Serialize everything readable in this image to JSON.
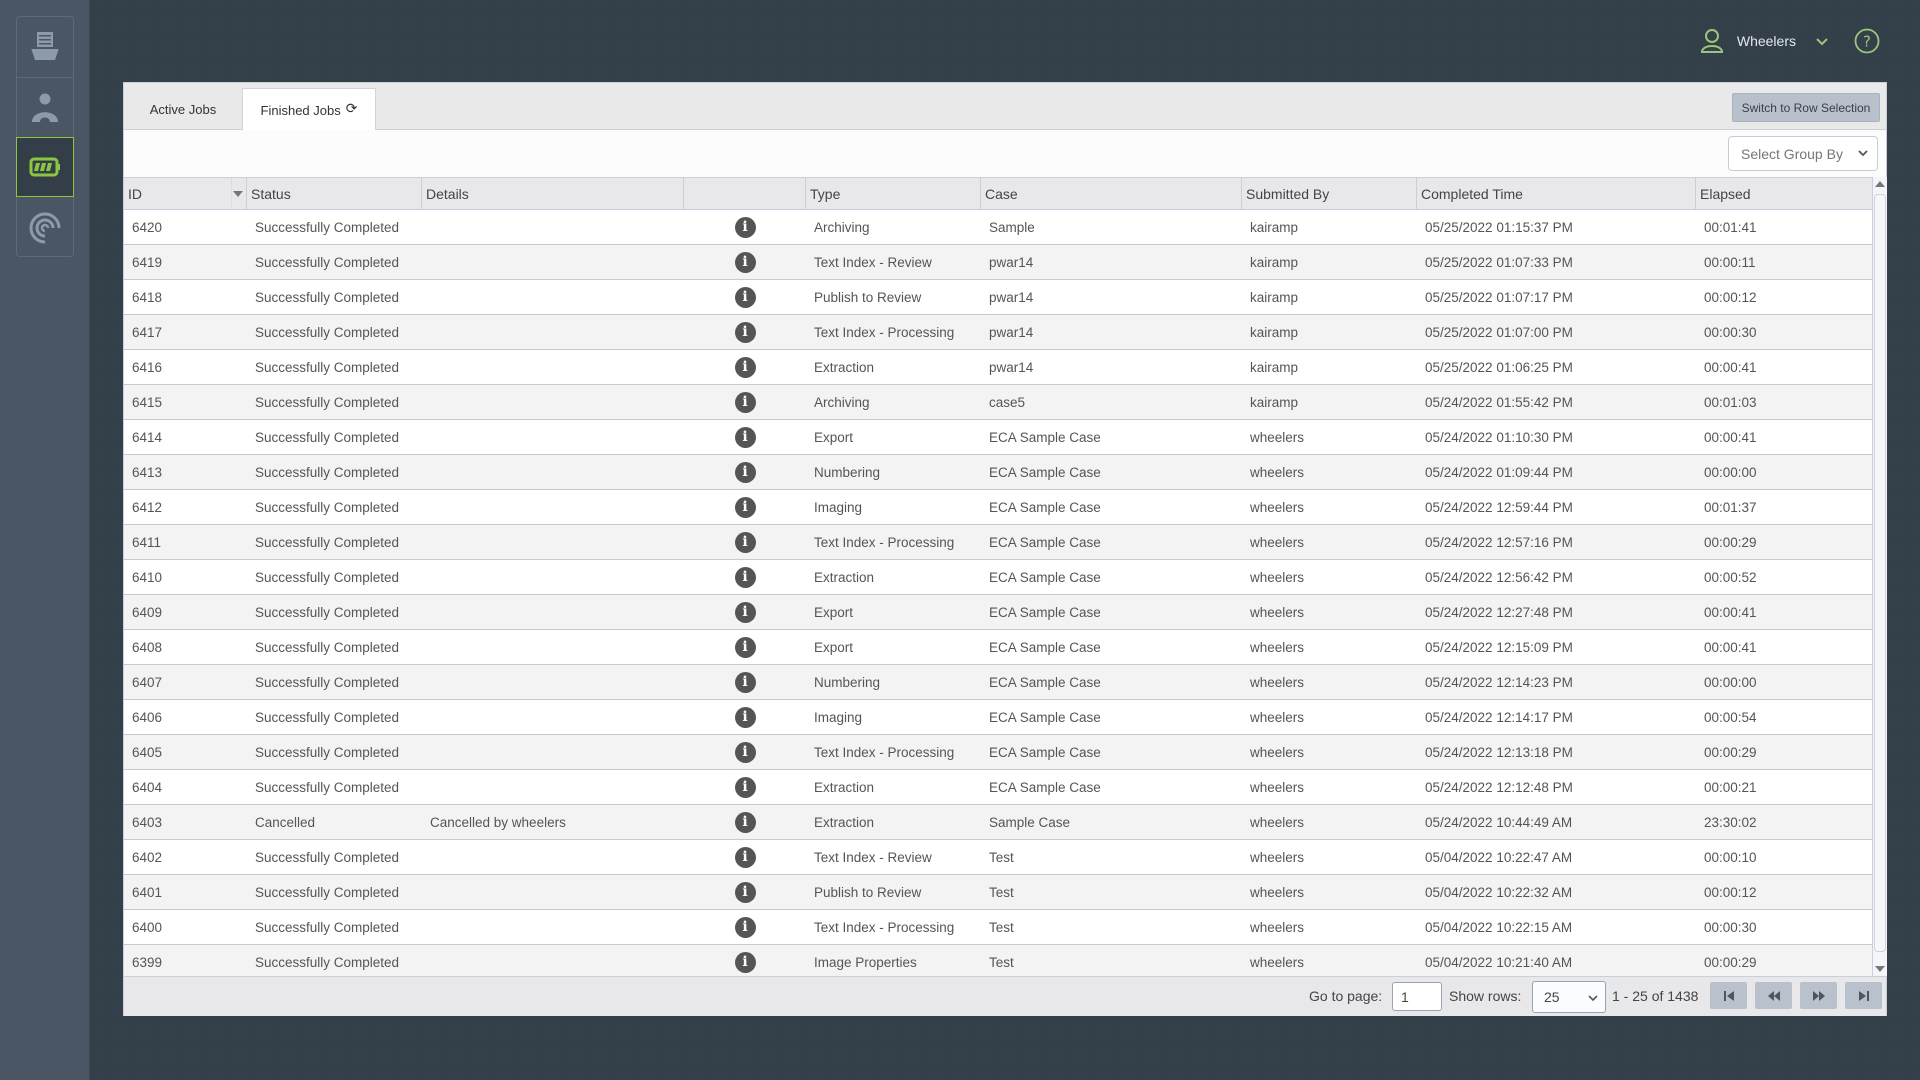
{
  "sidebar": {
    "items": [
      {
        "name": "inbox-tray",
        "active": false
      },
      {
        "name": "user",
        "active": false
      },
      {
        "name": "jobs-battery",
        "active": true
      },
      {
        "name": "signal",
        "active": false
      }
    ],
    "accent_color": "#8cc63f"
  },
  "user": {
    "name": "Wheelers"
  },
  "tabs": [
    {
      "label": "Active Jobs",
      "active": false
    },
    {
      "label": "Finished Jobs",
      "active": true
    }
  ],
  "toolbar": {
    "row_selection_label": "Switch to Row Selection",
    "group_by_placeholder": "Select Group By"
  },
  "table": {
    "columns": [
      "ID",
      "Status",
      "Details",
      "",
      "Type",
      "Case",
      "Submitted By",
      "Completed Time",
      "Elapsed"
    ],
    "sort": {
      "column": "ID",
      "direction": "desc"
    },
    "rows": [
      {
        "id": "6420",
        "status": "Successfully Completed",
        "details": "",
        "type": "Archiving",
        "case": "Sample",
        "submitted_by": "kairamp",
        "completed": "05/25/2022 01:15:37 PM",
        "elapsed": "00:01:41"
      },
      {
        "id": "6419",
        "status": "Successfully Completed",
        "details": "",
        "type": "Text Index - Review",
        "case": "pwar14",
        "submitted_by": "kairamp",
        "completed": "05/25/2022 01:07:33 PM",
        "elapsed": "00:00:11"
      },
      {
        "id": "6418",
        "status": "Successfully Completed",
        "details": "",
        "type": "Publish to Review",
        "case": "pwar14",
        "submitted_by": "kairamp",
        "completed": "05/25/2022 01:07:17 PM",
        "elapsed": "00:00:12"
      },
      {
        "id": "6417",
        "status": "Successfully Completed",
        "details": "",
        "type": "Text Index - Processing",
        "case": "pwar14",
        "submitted_by": "kairamp",
        "completed": "05/25/2022 01:07:00 PM",
        "elapsed": "00:00:30"
      },
      {
        "id": "6416",
        "status": "Successfully Completed",
        "details": "",
        "type": "Extraction",
        "case": "pwar14",
        "submitted_by": "kairamp",
        "completed": "05/25/2022 01:06:25 PM",
        "elapsed": "00:00:41"
      },
      {
        "id": "6415",
        "status": "Successfully Completed",
        "details": "",
        "type": "Archiving",
        "case": "case5",
        "submitted_by": "kairamp",
        "completed": "05/24/2022 01:55:42 PM",
        "elapsed": "00:01:03"
      },
      {
        "id": "6414",
        "status": "Successfully Completed",
        "details": "",
        "type": "Export",
        "case": "ECA Sample Case",
        "submitted_by": "wheelers",
        "completed": "05/24/2022 01:10:30 PM",
        "elapsed": "00:00:41"
      },
      {
        "id": "6413",
        "status": "Successfully Completed",
        "details": "",
        "type": "Numbering",
        "case": "ECA Sample Case",
        "submitted_by": "wheelers",
        "completed": "05/24/2022 01:09:44 PM",
        "elapsed": "00:00:00"
      },
      {
        "id": "6412",
        "status": "Successfully Completed",
        "details": "",
        "type": "Imaging",
        "case": "ECA Sample Case",
        "submitted_by": "wheelers",
        "completed": "05/24/2022 12:59:44 PM",
        "elapsed": "00:01:37"
      },
      {
        "id": "6411",
        "status": "Successfully Completed",
        "details": "",
        "type": "Text Index - Processing",
        "case": "ECA Sample Case",
        "submitted_by": "wheelers",
        "completed": "05/24/2022 12:57:16 PM",
        "elapsed": "00:00:29"
      },
      {
        "id": "6410",
        "status": "Successfully Completed",
        "details": "",
        "type": "Extraction",
        "case": "ECA Sample Case",
        "submitted_by": "wheelers",
        "completed": "05/24/2022 12:56:42 PM",
        "elapsed": "00:00:52"
      },
      {
        "id": "6409",
        "status": "Successfully Completed",
        "details": "",
        "type": "Export",
        "case": "ECA Sample Case",
        "submitted_by": "wheelers",
        "completed": "05/24/2022 12:27:48 PM",
        "elapsed": "00:00:41"
      },
      {
        "id": "6408",
        "status": "Successfully Completed",
        "details": "",
        "type": "Export",
        "case": "ECA Sample Case",
        "submitted_by": "wheelers",
        "completed": "05/24/2022 12:15:09 PM",
        "elapsed": "00:00:41"
      },
      {
        "id": "6407",
        "status": "Successfully Completed",
        "details": "",
        "type": "Numbering",
        "case": "ECA Sample Case",
        "submitted_by": "wheelers",
        "completed": "05/24/2022 12:14:23 PM",
        "elapsed": "00:00:00"
      },
      {
        "id": "6406",
        "status": "Successfully Completed",
        "details": "",
        "type": "Imaging",
        "case": "ECA Sample Case",
        "submitted_by": "wheelers",
        "completed": "05/24/2022 12:14:17 PM",
        "elapsed": "00:00:54"
      },
      {
        "id": "6405",
        "status": "Successfully Completed",
        "details": "",
        "type": "Text Index - Processing",
        "case": "ECA Sample Case",
        "submitted_by": "wheelers",
        "completed": "05/24/2022 12:13:18 PM",
        "elapsed": "00:00:29"
      },
      {
        "id": "6404",
        "status": "Successfully Completed",
        "details": "",
        "type": "Extraction",
        "case": "ECA Sample Case",
        "submitted_by": "wheelers",
        "completed": "05/24/2022 12:12:48 PM",
        "elapsed": "00:00:21"
      },
      {
        "id": "6403",
        "status": "Cancelled",
        "details": "Cancelled by wheelers",
        "type": "Extraction",
        "case": "Sample Case",
        "submitted_by": "wheelers",
        "completed": "05/24/2022 10:44:49 AM",
        "elapsed": "23:30:02"
      },
      {
        "id": "6402",
        "status": "Successfully Completed",
        "details": "",
        "type": "Text Index - Review",
        "case": "Test",
        "submitted_by": "wheelers",
        "completed": "05/04/2022 10:22:47 AM",
        "elapsed": "00:00:10"
      },
      {
        "id": "6401",
        "status": "Successfully Completed",
        "details": "",
        "type": "Publish to Review",
        "case": "Test",
        "submitted_by": "wheelers",
        "completed": "05/04/2022 10:22:32 AM",
        "elapsed": "00:00:12"
      },
      {
        "id": "6400",
        "status": "Successfully Completed",
        "details": "",
        "type": "Text Index - Processing",
        "case": "Test",
        "submitted_by": "wheelers",
        "completed": "05/04/2022 10:22:15 AM",
        "elapsed": "00:00:30"
      },
      {
        "id": "6399",
        "status": "Successfully Completed",
        "details": "",
        "type": "Image Properties",
        "case": "Test",
        "submitted_by": "wheelers",
        "completed": "05/04/2022 10:21:40 AM",
        "elapsed": "00:00:29"
      }
    ]
  },
  "pagination": {
    "go_to_page_label": "Go to page:",
    "page_value": "1",
    "show_rows_label": "Show rows:",
    "rows_value": "25",
    "range_text": "1 - 25 of 1438"
  }
}
